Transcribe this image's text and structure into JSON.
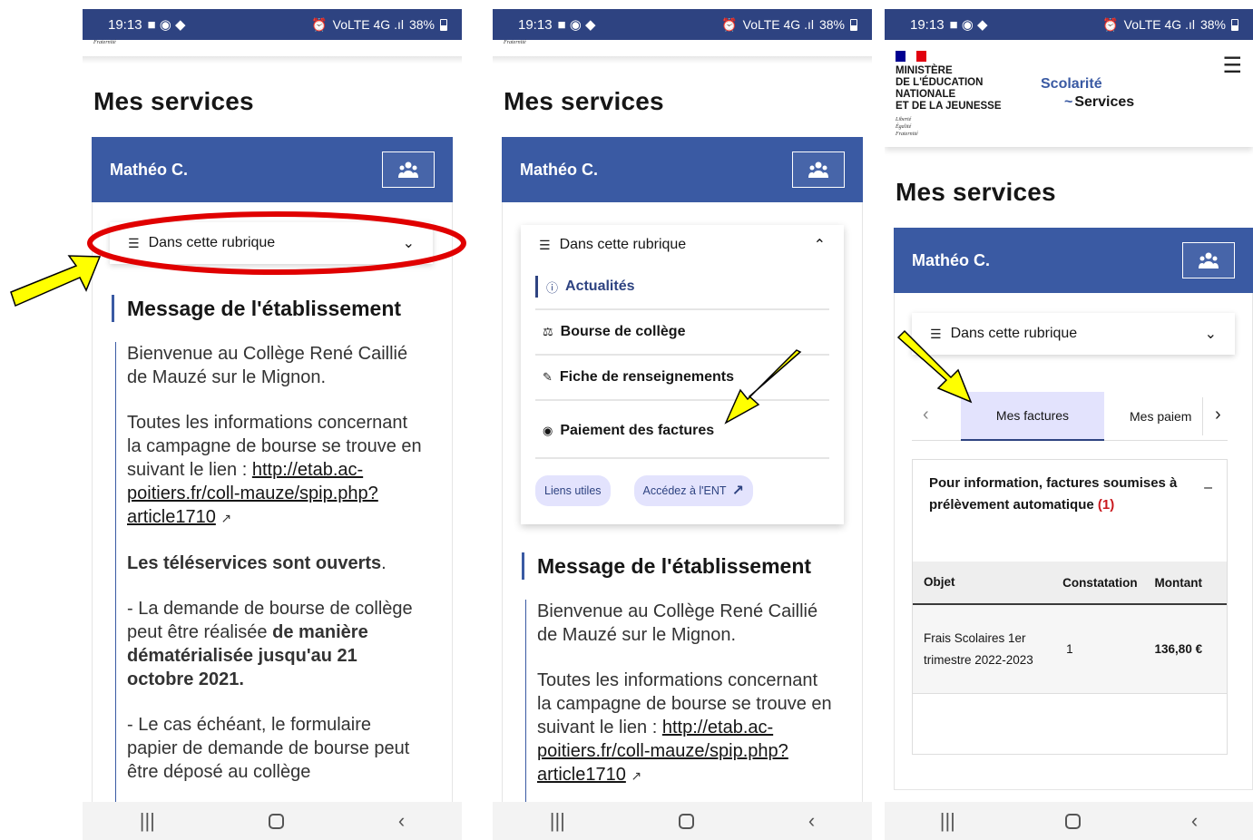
{
  "status_bar": {
    "time": "19:13",
    "signal": "VoLTE 4G .ıl",
    "battery": "38%"
  },
  "fraternite_small": "Fraternité",
  "page_title": "Mes services",
  "user": {
    "name": "Mathéo C."
  },
  "rubrique_label": "Dans cette rubrique",
  "section_title": "Message de l'établissement",
  "message": {
    "welcome": "Bienvenue au Collège René Caillié de Mauzé sur le Mignon.",
    "campaign_prefix": "Toutes les informations concernant la campagne de bourse se trouve en suivant le lien : ",
    "link": "http://etab.ac-poitiers.fr/coll-mauze/spip.php?article1710",
    "teleservices_bold": "Les téléservices sont ouverts",
    "teleservices_end": ".",
    "demande_prefix": "- La demande de bourse de collège peut être réalisée ",
    "demande_bold": "de manière dématérialisée jusqu'au 21 octobre 2021.",
    "papier": "- Le cas échéant, le formulaire papier de demande de bourse peut être déposé au collège"
  },
  "dropdown": {
    "items": [
      {
        "label": "Actualités",
        "icon": "info-icon"
      },
      {
        "label": "Bourse de collège",
        "icon": "hand-coins-icon"
      },
      {
        "label": "Fiche de renseignements",
        "icon": "edit-icon"
      },
      {
        "label": "Paiement des factures",
        "icon": "coin-icon"
      }
    ],
    "liens_utiles": "Liens utiles",
    "ent": "Accédez à l'ENT"
  },
  "header3": {
    "ministere": "MINISTÈRE\nDE L'ÉDUCATION\nNATIONALE\nET DE LA JEUNESSE",
    "devise": "Liberté\nÉgalité\nFraternité",
    "scolarite": "Scolarité",
    "services": "Services"
  },
  "tabs": {
    "active": "Mes factures",
    "next": "Mes paiem"
  },
  "info": {
    "title": "Pour information, factures soumises à prélèvement automatique",
    "count": "(1)",
    "collapse": "–"
  },
  "table": {
    "headers": [
      "Objet",
      "Constatation",
      "Montant"
    ],
    "rows": [
      {
        "objet": "Frais Scolaires 1er trimestre 2022-2023",
        "constatation": "1",
        "montant": "136,80 €"
      }
    ]
  },
  "colors": {
    "header_blue": "#2e4381",
    "card_blue": "#3a5aa3",
    "annotation_yellow": "#ffff00",
    "annotation_red": "#e00000"
  }
}
